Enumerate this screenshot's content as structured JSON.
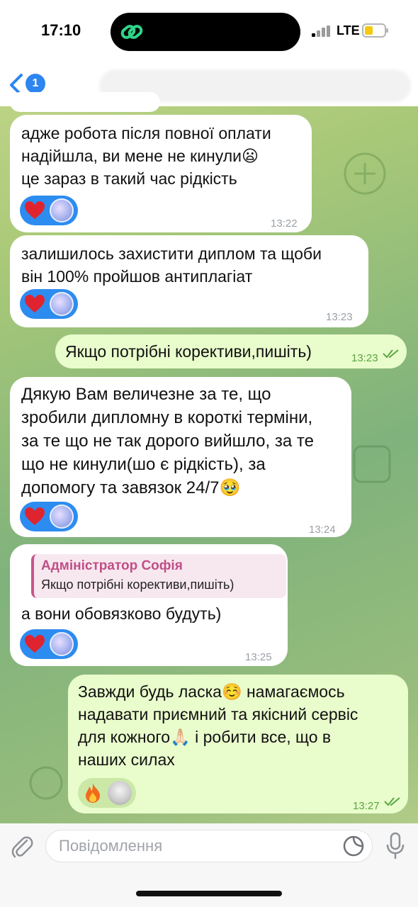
{
  "status_bar": {
    "time": "17:10",
    "network": "LTE"
  },
  "nav": {
    "back_count": "1"
  },
  "messages": [
    {
      "text": "адже робота після повної оплати\nнадійшла, ви мене не кинули😦\nце зараз в такий час рідкість",
      "time": "13:22",
      "reactions": [
        "heart",
        "avatar"
      ]
    },
    {
      "text": "залишилось захистити диплом та щоби\nвін 100% пройшов антиплагіат",
      "time": "13:23",
      "reactions": [
        "heart",
        "avatar"
      ]
    },
    {
      "text": "Якщо потрібні корективи,пишіть)",
      "time": "13:23",
      "status": "read"
    },
    {
      "text": "Дякую Вам величезне за те, що\nзробили дипломну в короткі терміни,\nза те що не так дорого вийшло, за те\nщо не кинули(шо є рідкість), за\nдопомогу та завязок 24/7🥹",
      "time": "13:24",
      "reactions": [
        "heart",
        "avatar"
      ]
    },
    {
      "reply_author": "Адміністратор Софія",
      "reply_text": "Якщо потрібні корективи,пишіть)",
      "text": "а вони обовязково будуть)",
      "time": "13:25",
      "reactions": [
        "heart",
        "avatar"
      ]
    },
    {
      "text": "Завжди будь ласка☺️ намагаємось\nнадавати приємний та якісний сервіс\nдля кожного🙏🏻 і робити все, що в\nнаших силах",
      "time": "13:27",
      "status": "read",
      "reactions": [
        "fire",
        "photo-avatar"
      ]
    }
  ],
  "input": {
    "placeholder": "Повідомлення"
  },
  "colors": {
    "accent": "#2d85f0",
    "outgoing_bubble": "#e9fccc",
    "heart": "#e0242f"
  }
}
